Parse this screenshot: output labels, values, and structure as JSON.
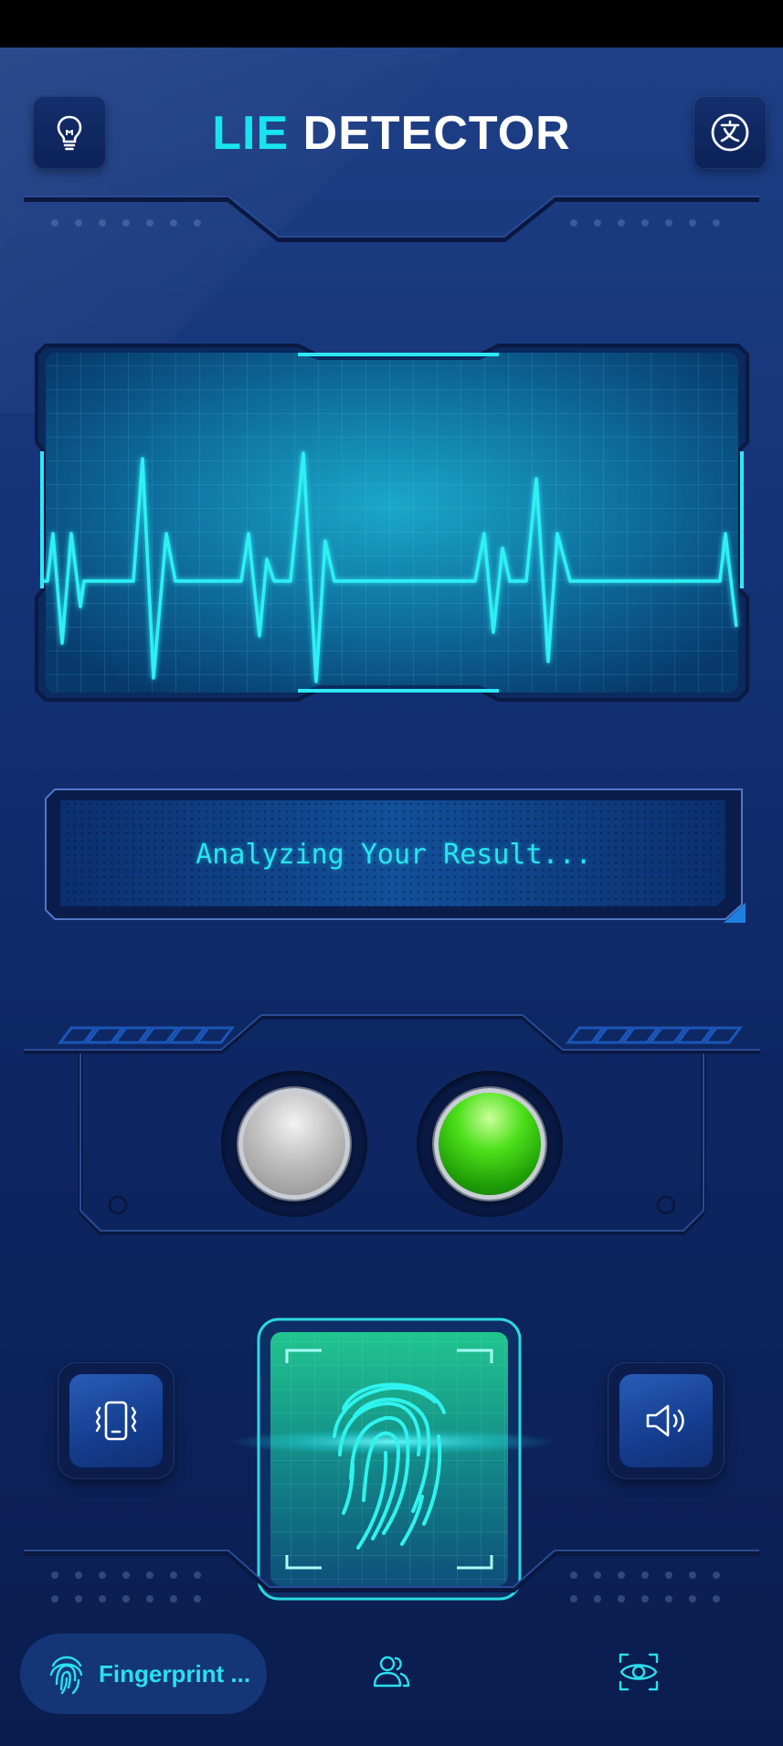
{
  "header": {
    "title_accent": "LIE",
    "title_rest": "DETECTOR",
    "left_icon": "lightbulb-icon",
    "right_icon": "translate-icon"
  },
  "monitor": {
    "label": "heartbeat-waveform"
  },
  "result": {
    "text": "Analyzing Your Result..."
  },
  "indicators": {
    "left_light": "grey",
    "right_light": "green"
  },
  "controls": {
    "left_icon": "vibration-icon",
    "right_icon": "speaker-icon",
    "scanner_icon": "fingerprint-icon"
  },
  "bottom_nav": {
    "items": [
      {
        "label": "Fingerprint ...",
        "icon": "fingerprint-icon",
        "active": true
      },
      {
        "label": "",
        "icon": "users-icon",
        "active": false
      },
      {
        "label": "",
        "icon": "eye-scan-icon",
        "active": false
      }
    ]
  },
  "colors": {
    "accent": "#19e3f0",
    "background_top": "#1e3f86",
    "background_bottom": "#0a1d4f",
    "green_light": "#4de01a"
  }
}
